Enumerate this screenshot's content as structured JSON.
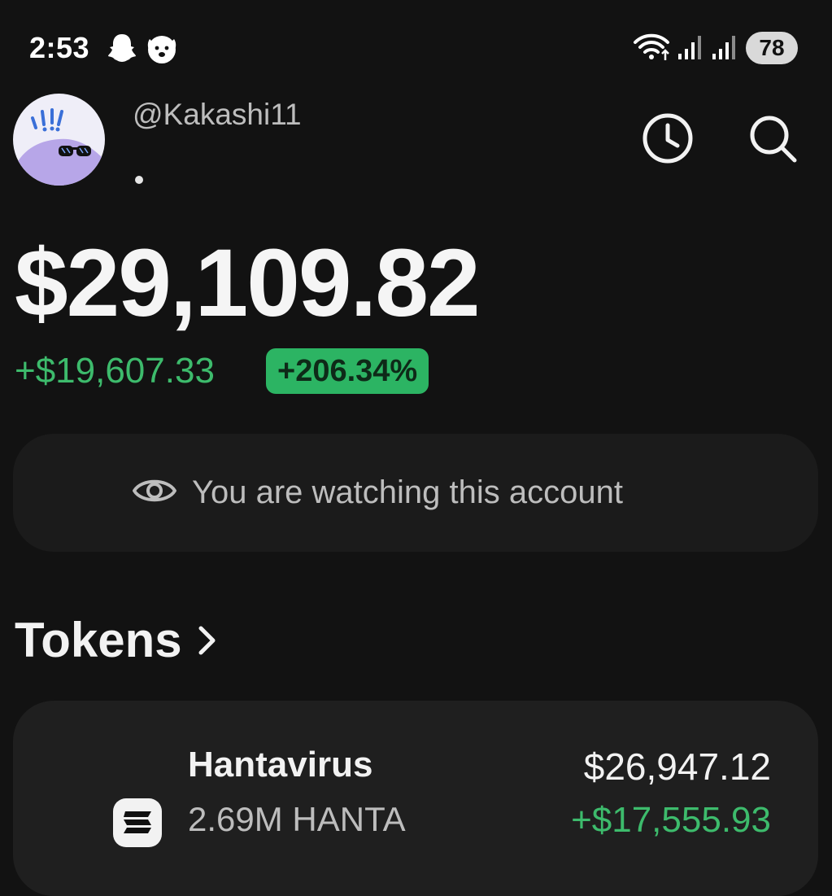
{
  "status_bar": {
    "time": "2:53",
    "battery": "78"
  },
  "header": {
    "username": "@Kakashi11"
  },
  "portfolio": {
    "balance": "$29,109.82",
    "change_amount": "+$19,607.33",
    "change_percent": "+206.34%"
  },
  "watch_banner": {
    "text": "You are watching this account"
  },
  "tokens": {
    "title": "Tokens",
    "items": [
      {
        "name": "Hantavirus",
        "amount": "2.69M HANTA",
        "value": "$26,947.12",
        "change": "+$17,555.93"
      }
    ]
  },
  "colors": {
    "background": "#121212",
    "positive": "#3dbb6c",
    "pill": "#2cb463",
    "card": "#1f1f1f",
    "avatar_bg": "#efeef8",
    "avatar_blob": "#b7a6e8"
  },
  "icons": [
    "snapchat-icon",
    "dog-icon",
    "wifi-icon",
    "signal-icon",
    "clock-icon",
    "search-icon",
    "eye-icon",
    "chevron-right-icon",
    "token-logo-icon"
  ]
}
